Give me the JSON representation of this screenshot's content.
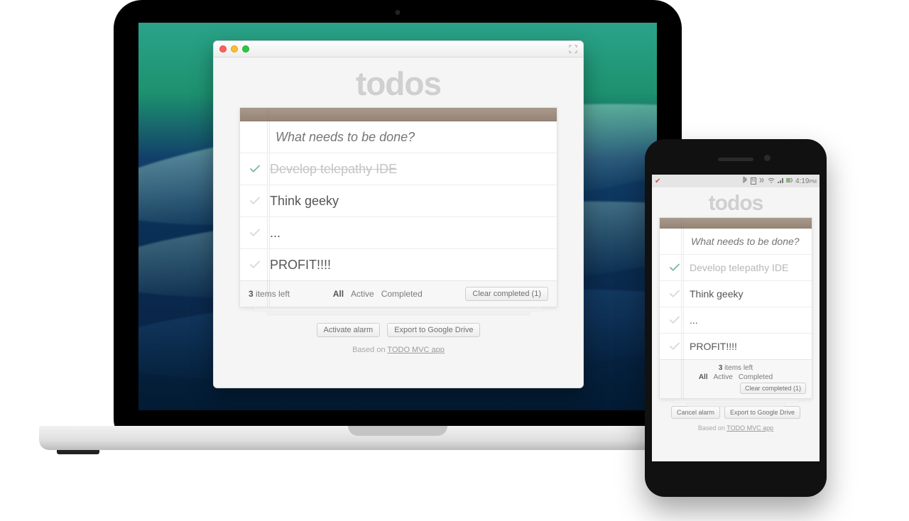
{
  "desktop": {
    "app_title": "todos",
    "new_todo_placeholder": "What needs to be done?",
    "items": [
      {
        "label": "Develop telepathy IDE",
        "done": true
      },
      {
        "label": "Think geeky",
        "done": false
      },
      {
        "label": "...",
        "done": false
      },
      {
        "label": "PROFIT!!!!",
        "done": false
      }
    ],
    "footer": {
      "count_number": "3",
      "count_text": " items left",
      "filters": {
        "all": "All",
        "active": "Active",
        "completed": "Completed",
        "selected": "all"
      },
      "clear_label": "Clear completed (1)"
    },
    "buttons": {
      "alarm": "Activate alarm",
      "export": "Export to Google Drive"
    },
    "credit_prefix": "Based on ",
    "credit_link": "TODO MVC app"
  },
  "phone": {
    "status": {
      "carrier_checkmark": "✔",
      "time": "4:19",
      "ampm": "PM"
    },
    "app_title": "todos",
    "new_todo_placeholder": "What needs to be done?",
    "items": [
      {
        "label": "Develop telepathy IDE",
        "done": true
      },
      {
        "label": "Think geeky",
        "done": false
      },
      {
        "label": "...",
        "done": false
      },
      {
        "label": "PROFIT!!!!",
        "done": false
      }
    ],
    "footer": {
      "count_number": "3",
      "count_text": " items left",
      "filters": {
        "all": "All",
        "active": "Active",
        "completed": "Completed",
        "selected": "all"
      },
      "clear_label": "Clear completed (1)"
    },
    "buttons": {
      "alarm": "Cancel alarm",
      "export": "Export to Google Drive"
    },
    "credit_prefix": "Based on ",
    "credit_link": "TODO MVC app"
  }
}
